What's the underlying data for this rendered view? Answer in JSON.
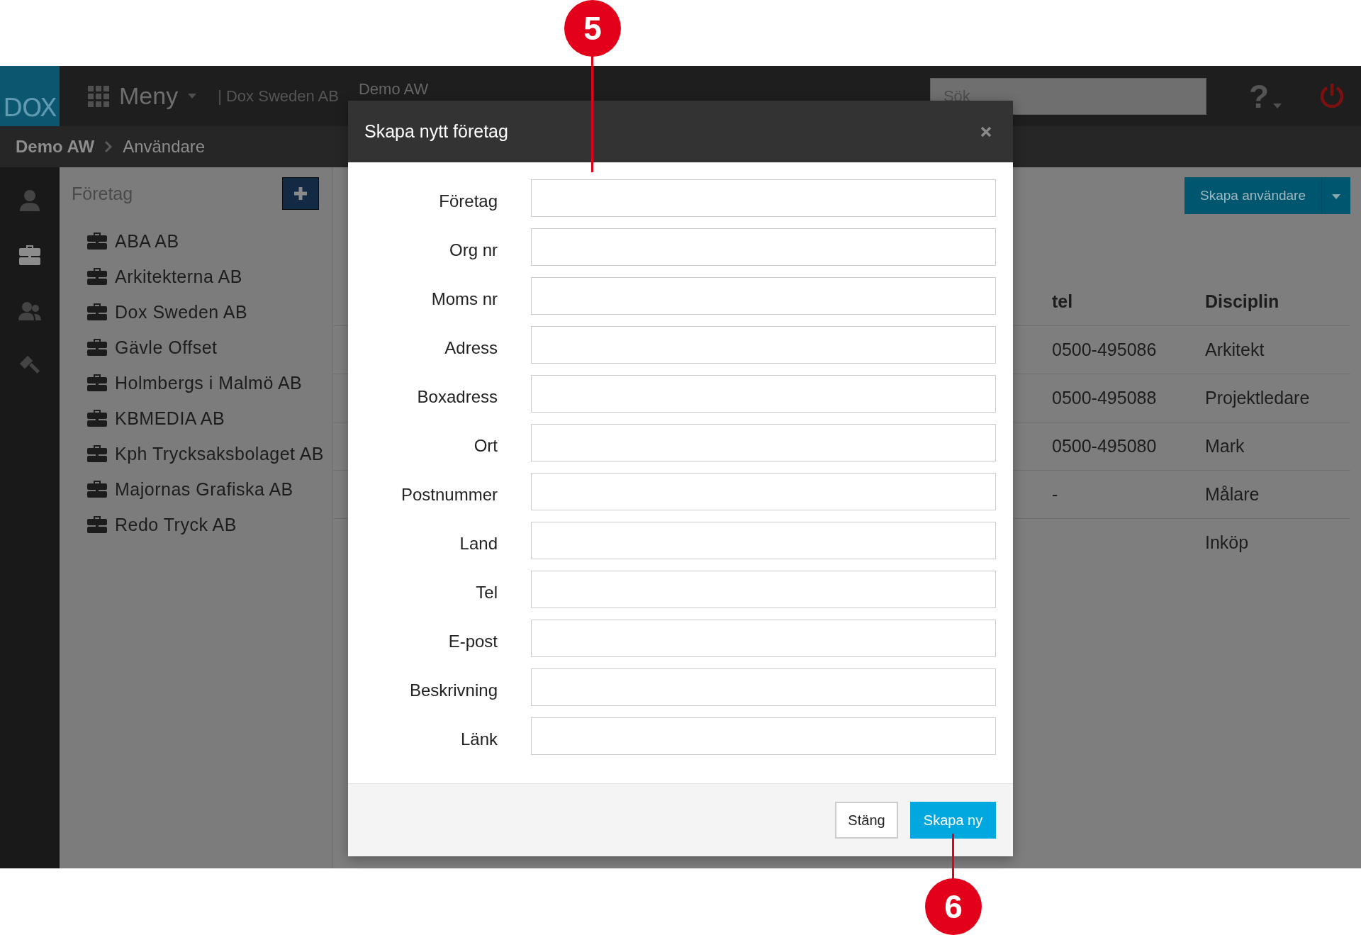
{
  "header": {
    "logo": "DOX",
    "menu": "Meny",
    "company": "| Dox Sweden AB",
    "project": "Demo AW",
    "search": {
      "placeholder": "Sök"
    },
    "help": "?"
  },
  "breadcrumb": [
    "Demo AW",
    "Användare"
  ],
  "rail": [
    {
      "kind": "user",
      "selected": false
    },
    {
      "kind": "briefcase",
      "selected": true
    },
    {
      "kind": "users",
      "selected": false
    },
    {
      "kind": "gavel",
      "selected": false
    }
  ],
  "companies": {
    "title": "Företag",
    "items": [
      "ABA AB",
      "Arkitekterna AB",
      "Dox Sweden AB",
      "Gävle Offset",
      "Holmbergs i Malmö AB",
      "KBMEDIA AB",
      "Kph Trycksaksbolaget AB",
      "Majornas Grafiska AB",
      "Redo Tryck AB"
    ]
  },
  "main": {
    "button": "Skapa användare",
    "table": {
      "columns": [
        "tel",
        "Disciplin"
      ],
      "rows": [
        {
          "tel": "0500-495086",
          "discipline": "Arkitekt"
        },
        {
          "tel": "0500-495088",
          "discipline": "Projektledare"
        },
        {
          "tel": "0500-495080",
          "discipline": "Mark"
        },
        {
          "tel": "-",
          "discipline": "Målare"
        },
        {
          "discipline": "Inköp"
        }
      ]
    }
  },
  "dialog": {
    "title": "Skapa nytt företag",
    "fields": [
      {
        "label": "Företag"
      },
      {
        "label": "Org nr"
      },
      {
        "label": "Moms nr"
      },
      {
        "label": "Adress"
      },
      {
        "label": "Boxadress"
      },
      {
        "label": "Ort"
      },
      {
        "label": "Postnummer"
      },
      {
        "label": "Land"
      },
      {
        "label": "Tel"
      },
      {
        "label": "E-post"
      },
      {
        "label": "Beskrivning"
      },
      {
        "label": "Länk"
      }
    ],
    "buttons": [
      {
        "label": "Stäng",
        "kind": "secondary"
      },
      {
        "label": "Skapa ny",
        "kind": "primary"
      }
    ]
  },
  "callouts": [
    "5",
    "6"
  ]
}
